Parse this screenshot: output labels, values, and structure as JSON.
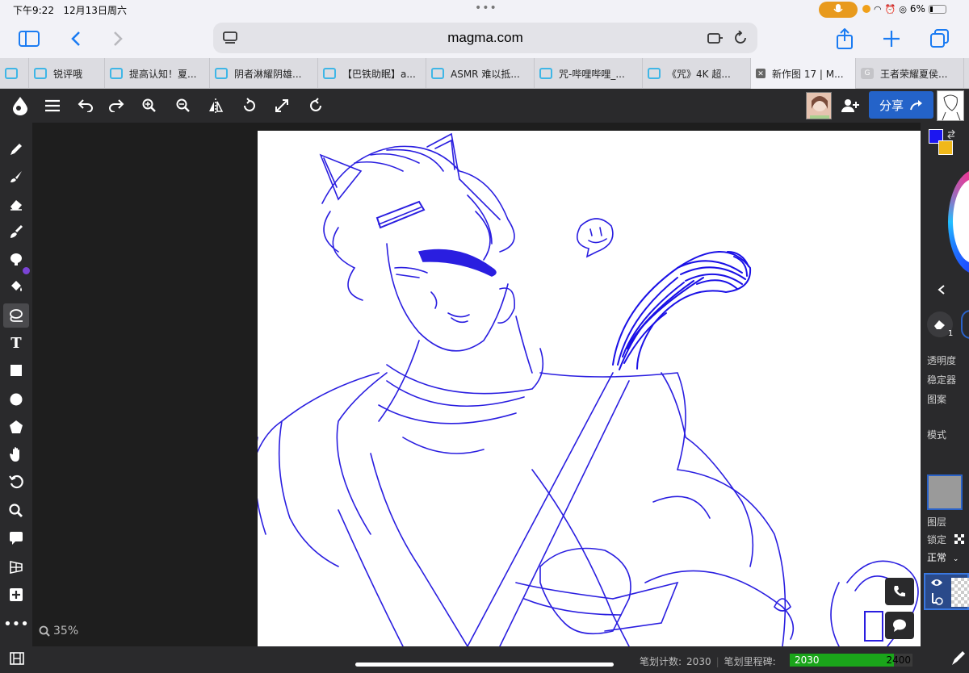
{
  "status": {
    "time": "下午9:22",
    "date": "12月13日周六",
    "battery_text": "6%"
  },
  "browser": {
    "url": "magma.com",
    "tabs": [
      {
        "label": "锐评哦",
        "active": false
      },
      {
        "label": "",
        "active": false
      },
      {
        "label": "提高认知！夏...",
        "active": false
      },
      {
        "label": "阴者淋耀阴雄...",
        "active": false
      },
      {
        "label": "【巴铁助眠】a...",
        "active": false
      },
      {
        "label": "ASMR 难以抵...",
        "active": false
      },
      {
        "label": "咒-哔哩哔哩_...",
        "active": false
      },
      {
        "label": "《咒》4K 超...",
        "active": false
      },
      {
        "label": "新作图 17 | M...",
        "active": true
      },
      {
        "label": "王者荣耀夏侯...",
        "active": false
      }
    ]
  },
  "app": {
    "share_label": "分享",
    "zoom_label": "35%",
    "right_panel": {
      "opacity_label": "透明度",
      "stabilizer_label": "稳定器",
      "pattern_label": "图案",
      "mode_label": "模式",
      "layers_label": "图层",
      "lock_label": "锁定",
      "blend_mode": "正常",
      "eraser_count": "1"
    },
    "bottom": {
      "stroke_count_label": "笔划计数:",
      "stroke_count": "2030",
      "milestone_label": "笔划里程碑:",
      "milestone_current": "2030",
      "milestone_target": "2400",
      "milestone_progress": 0.846
    },
    "colors": {
      "foreground": "#1c16f0",
      "background": "#f0b81a",
      "accent": "#2463c9"
    }
  }
}
